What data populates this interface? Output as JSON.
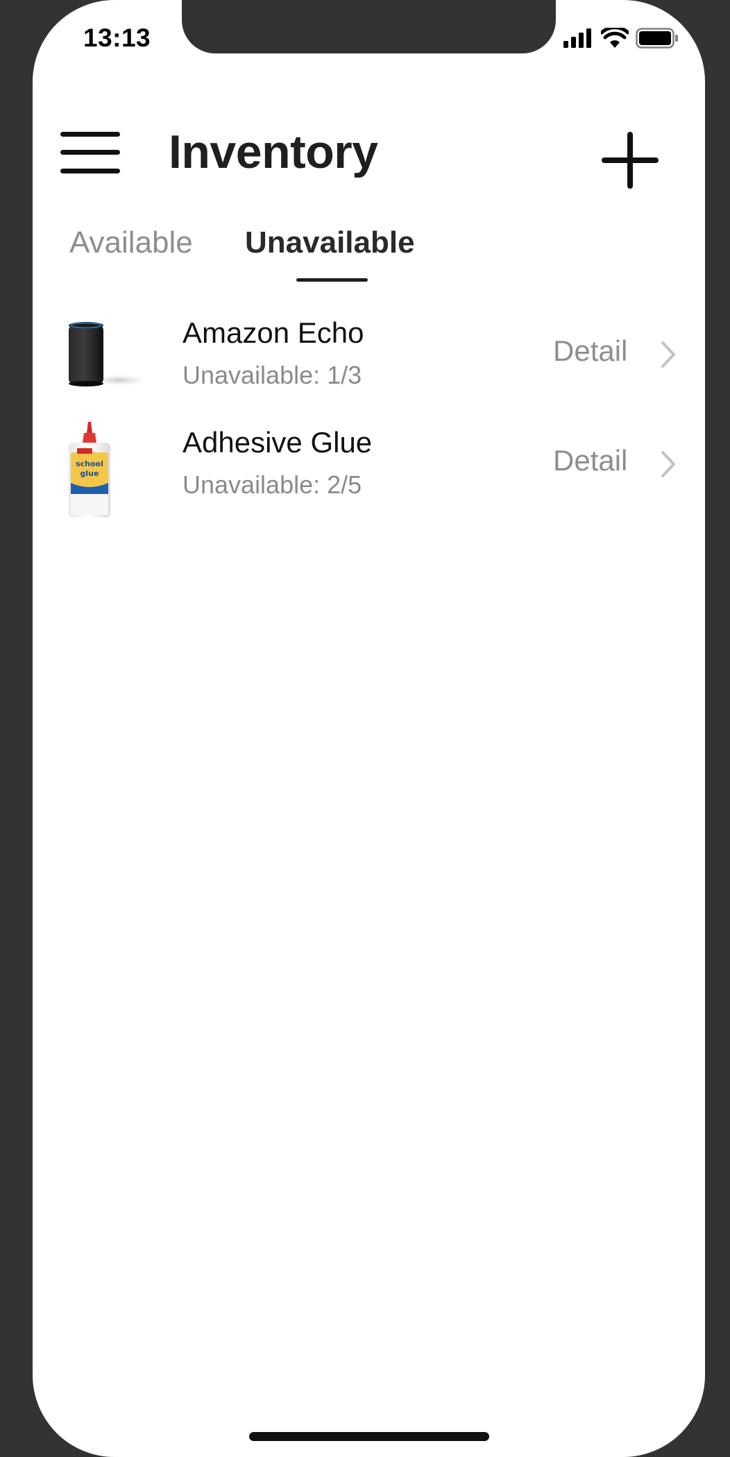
{
  "status_bar": {
    "time": "13:13"
  },
  "header": {
    "title": "Inventory"
  },
  "tabs": [
    {
      "label": "Available",
      "active": false
    },
    {
      "label": "Unavailable",
      "active": true
    }
  ],
  "items": [
    {
      "name": "Amazon Echo",
      "status": "Unavailable: 1/3",
      "detail_label": "Detail",
      "thumbnail": "amazon-echo-speaker"
    },
    {
      "name": "Adhesive Glue",
      "status": "Unavailable: 2/5",
      "detail_label": "Detail",
      "thumbnail": "school-glue-bottle",
      "thumbnail_text": [
        "school",
        "glue"
      ]
    }
  ],
  "colors": {
    "background": "#333333",
    "screen": "#ffffff",
    "active_tab": "#2a2a2a",
    "inactive_text": "#8e8e8e"
  }
}
